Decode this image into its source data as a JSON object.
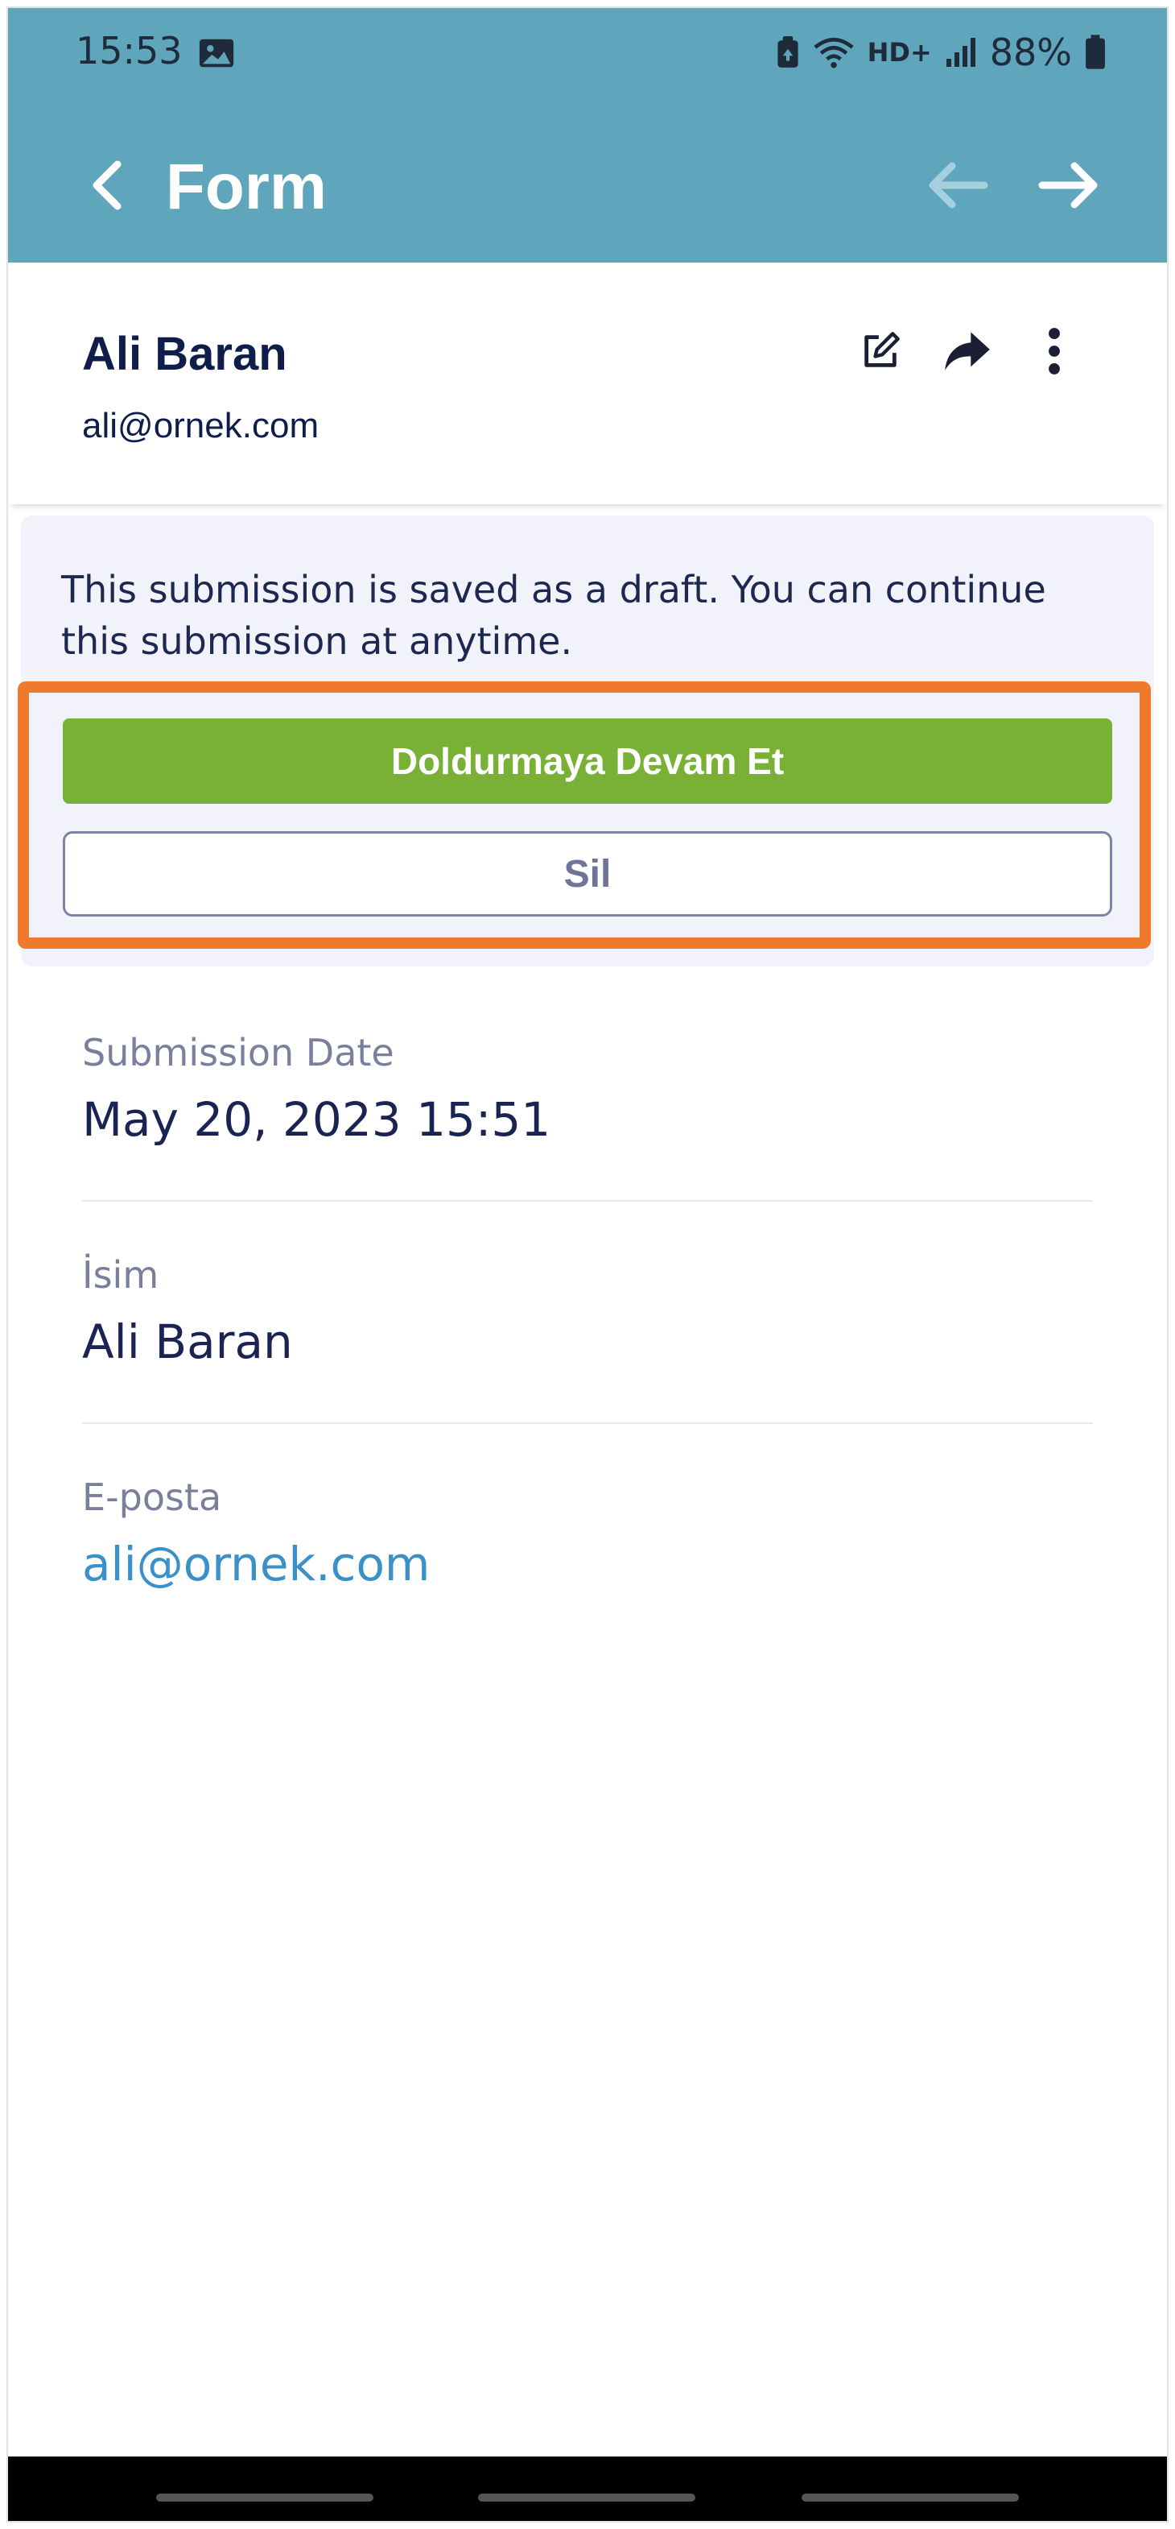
{
  "status_bar": {
    "time": "15:53",
    "network": "HD+",
    "battery": "88%"
  },
  "header": {
    "title": "Form",
    "icons": {
      "back": "chevron-left-icon",
      "prev": "arrow-left-icon",
      "next": "arrow-right-icon"
    },
    "color": "#5fa5bc"
  },
  "submitter": {
    "name": "Ali Baran",
    "email": "ali@ornek.com",
    "actions": [
      "edit-icon",
      "share-icon",
      "more-vertical-icon"
    ]
  },
  "draft": {
    "message": "This submission is saved as a draft. You can continue this submission at anytime.",
    "continue_label": "Doldurmaya Devam Et",
    "delete_label": "Sil",
    "continue_color": "#78b135",
    "highlight_color": "#f07a2c"
  },
  "fields": [
    {
      "label": "Submission Date",
      "value": "May 20, 2023 15:51"
    },
    {
      "label": "İsim",
      "value": "Ali Baran"
    },
    {
      "label": "E-posta",
      "value": "ali@ornek.com"
    }
  ]
}
